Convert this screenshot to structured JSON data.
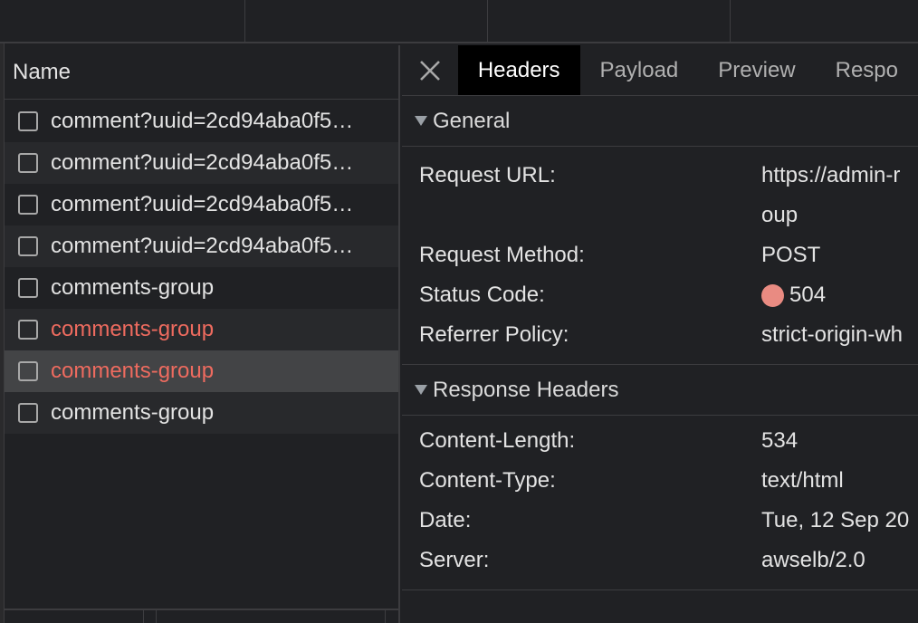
{
  "requests": {
    "header": "Name",
    "items": [
      {
        "name": "comment?uuid=2cd94aba0f5…",
        "status": "normal"
      },
      {
        "name": "comment?uuid=2cd94aba0f5…",
        "status": "normal"
      },
      {
        "name": "comment?uuid=2cd94aba0f5…",
        "status": "normal"
      },
      {
        "name": "comment?uuid=2cd94aba0f5…",
        "status": "normal"
      },
      {
        "name": "comments-group",
        "status": "normal"
      },
      {
        "name": "comments-group",
        "status": "error"
      },
      {
        "name": "comments-group",
        "status": "error",
        "selected": true
      },
      {
        "name": "comments-group",
        "status": "normal"
      }
    ]
  },
  "tabs": [
    "Headers",
    "Payload",
    "Preview",
    "Respo"
  ],
  "general": {
    "title": "General",
    "request_url_label": "Request URL:",
    "request_url_value": "https://admin-r",
    "request_url_value_cont": "oup",
    "request_method_label": "Request Method:",
    "request_method_value": "POST",
    "status_code_label": "Status Code:",
    "status_code_value": "504",
    "referrer_policy_label": "Referrer Policy:",
    "referrer_policy_value": "strict-origin-wh"
  },
  "response_headers": {
    "title": "Response Headers",
    "content_length_label": "Content-Length:",
    "content_length_value": "534",
    "content_type_label": "Content-Type:",
    "content_type_value": "text/html",
    "date_label": "Date:",
    "date_value": "Tue, 12 Sep 20",
    "server_label": "Server:",
    "server_value": "awselb/2.0"
  },
  "colors": {
    "error_text": "#ee6b5f",
    "status_dot": "#e98b82",
    "active_tab_bg": "#000000"
  }
}
